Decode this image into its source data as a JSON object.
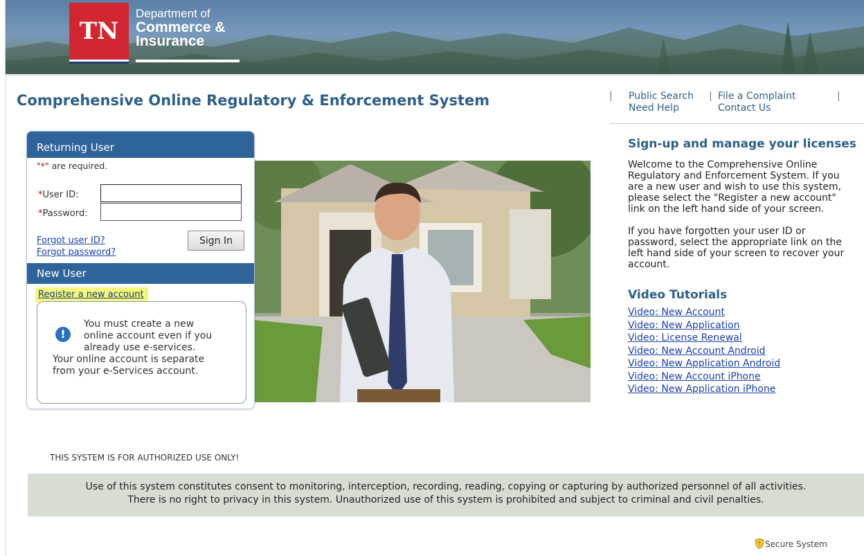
{
  "header": {
    "logo_mark": "TN",
    "dept_line1": "Department of",
    "dept_line2": "Commerce &",
    "dept_line3": "Insurance"
  },
  "title": "Comprehensive Online Regulatory & Enforcement System",
  "top_links": {
    "public_search": "Public Search",
    "file_complaint": "File a Complaint",
    "need_help": "Need Help",
    "contact_us": "Contact Us"
  },
  "login": {
    "heading": "Returning User",
    "required_prefix": "\"",
    "required_star": "*",
    "required_suffix": "\" are required.",
    "user_id_label": "User ID:",
    "password_label": "Password:",
    "user_id_value": "",
    "password_value": "",
    "forgot_user_id": "Forgot user ID?",
    "forgot_password": "Forgot password?",
    "sign_in": "Sign In"
  },
  "new_user": {
    "heading": "New User",
    "register_link": "Register a new account",
    "notice_line1": "You must create a new",
    "notice_line2": "online account even if you",
    "notice_line3": "already use e-services.",
    "notice_line4": "Your online account is separate",
    "notice_line5": "from your e-Services account."
  },
  "right": {
    "signup_heading": "Sign-up and manage your licenses",
    "welcome_text": "Welcome to the Comprehensive Online Regulatory and Enforcement System. If you are a new user and wish to use this system, please select the \"Register a new account\" link on the left hand side of your screen.",
    "forgot_text": "If you have forgotten your user ID or password, select the appropriate link on the left hand side of your screen to recover your account.",
    "video_heading": "Video Tutorials",
    "videos": [
      "Video: New Account",
      "Video: New Application",
      "Video: License Renewal",
      "Video: New Account Android",
      "Video: New Application Android",
      "Video: New Account iPhone",
      "Video: New Application iPhone"
    ]
  },
  "authorized_notice": "THIS SYSTEM IS FOR AUTHORIZED USE ONLY!",
  "disclaimer": {
    "line1": "Use of this system constitutes consent to monitoring, interception, recording, reading, copying or capturing by authorized personnel of all activities.",
    "line2": "There is no right to privacy in this system. Unauthorized use of this system is prohibited and subject to criminal and civil penalties."
  },
  "secure_label": "Secure System",
  "colors": {
    "brand_blue": "#2e6499",
    "title_blue": "#2c5f8a",
    "tn_red": "#d22630",
    "highlight": "#f4f77a"
  },
  "icons": {
    "info": "info-icon",
    "secure": "shield-icon"
  }
}
